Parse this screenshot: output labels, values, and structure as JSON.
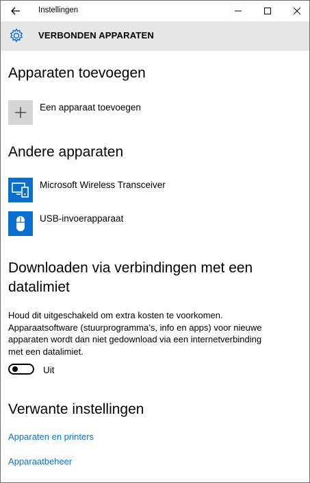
{
  "window": {
    "title": "Instellingen"
  },
  "header": {
    "title": "VERBONDEN APPARATEN"
  },
  "sections": {
    "add_devices": {
      "heading": "Apparaten toevoegen",
      "add_label": "Een apparaat toevoegen"
    },
    "other_devices": {
      "heading": "Andere apparaten",
      "items": [
        {
          "label": "Microsoft Wireless Transceiver",
          "icon": "monitor-keyboard-icon"
        },
        {
          "label": "USB-invoerapparaat",
          "icon": "mouse-icon"
        }
      ]
    },
    "metered": {
      "heading_line1": "Downloaden via verbindingen met een",
      "heading_line2": "datalimiet",
      "description_lines": [
        "Houd dit uitgeschakeld om extra kosten te voorkomen.",
        "Apparaatsoftware (stuurprogramma’s, info en apps) voor nieuwe",
        "apparaten wordt dan niet gedownload via een internetverbinding",
        "met een datalimiet."
      ],
      "toggle_state": "Uit"
    },
    "related": {
      "heading": "Verwante instellingen",
      "links": [
        "Apparaten en printers",
        "Apparaatbeheer"
      ]
    }
  },
  "colors": {
    "accent": "#0a6fcf",
    "header_bg": "#e6e6e6",
    "tile_bg": "#d5d5d5"
  }
}
